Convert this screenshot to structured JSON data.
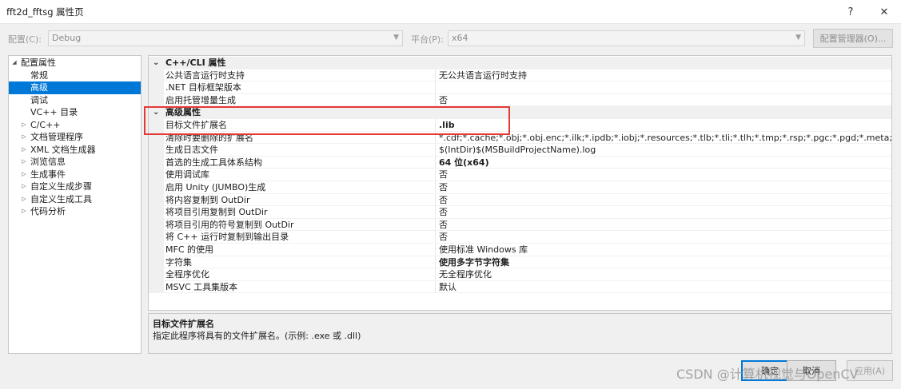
{
  "window": {
    "title": "fft2d_fftsg 属性页",
    "help_label": "?",
    "close_label": "✕"
  },
  "config": {
    "config_label": "配置(C):",
    "config_value": "Debug",
    "platform_label": "平台(P):",
    "platform_value": "x64",
    "manager_button": "配置管理器(O)..."
  },
  "tree": {
    "items": [
      {
        "label": "配置属性",
        "expander": "◢"
      },
      {
        "label": "常规",
        "expander": ""
      },
      {
        "label": "高级",
        "expander": "",
        "selected": true
      },
      {
        "label": "调试",
        "expander": ""
      },
      {
        "label": "VC++ 目录",
        "expander": ""
      },
      {
        "label": "C/C++",
        "expander": "▷"
      },
      {
        "label": "文档管理程序",
        "expander": "▷"
      },
      {
        "label": "XML 文档生成器",
        "expander": "▷"
      },
      {
        "label": "浏览信息",
        "expander": "▷"
      },
      {
        "label": "生成事件",
        "expander": "▷"
      },
      {
        "label": "自定义生成步骤",
        "expander": "▷"
      },
      {
        "label": "自定义生成工具",
        "expander": "▷"
      },
      {
        "label": "代码分析",
        "expander": "▷"
      }
    ]
  },
  "grid": {
    "sections": [
      {
        "title": "C++/CLI 属性",
        "rows": [
          {
            "name": "公共语言运行时支持",
            "value": "无公共语言运行时支持"
          },
          {
            "name": ".NET 目标框架版本",
            "value": ""
          },
          {
            "name": "启用托管增量生成",
            "value": "否"
          }
        ]
      },
      {
        "title": "高级属性",
        "rows": [
          {
            "name": "目标文件扩展名",
            "value": ".lib",
            "bold": true,
            "selected": true
          },
          {
            "name": "清除时要删除的扩展名",
            "value": "*.cdf;*.cache;*.obj;*.obj.enc;*.ilk;*.ipdb;*.iobj;*.resources;*.tlb;*.tli;*.tlh;*.tmp;*.rsp;*.pgc;*.pgd;*.meta;*.tlog;*.manife"
          },
          {
            "name": "生成日志文件",
            "value": "$(IntDir)$(MSBuildProjectName).log"
          },
          {
            "name": "首选的生成工具体系结构",
            "value": "64 位(x64)",
            "bold": true
          },
          {
            "name": "使用调试库",
            "value": "否"
          },
          {
            "name": "启用 Unity (JUMBO)生成",
            "value": "否"
          },
          {
            "name": "将内容复制到 OutDir",
            "value": "否"
          },
          {
            "name": "将项目引用复制到 OutDir",
            "value": "否"
          },
          {
            "name": "将项目引用的符号复制到 OutDir",
            "value": "否"
          },
          {
            "name": "将 C++ 运行时复制到输出目录",
            "value": "否"
          },
          {
            "name": "MFC 的使用",
            "value": "使用标准 Windows 库"
          },
          {
            "name": "字符集",
            "value": "使用多字节字符集",
            "bold": true
          },
          {
            "name": "全程序优化",
            "value": "无全程序优化"
          },
          {
            "name": "MSVC 工具集版本",
            "value": "默认"
          }
        ]
      }
    ]
  },
  "description": {
    "title": "目标文件扩展名",
    "text": "指定此程序将具有的文件扩展名。(示例: .exe 或 .dll)"
  },
  "buttons": {
    "ok": "确定",
    "cancel": "取消",
    "apply": "应用(A)"
  },
  "watermark": "CSDN @计算机视觉与OpenCV",
  "colors": {
    "selection": "#0078d7",
    "highlight_box": "#e53935"
  }
}
